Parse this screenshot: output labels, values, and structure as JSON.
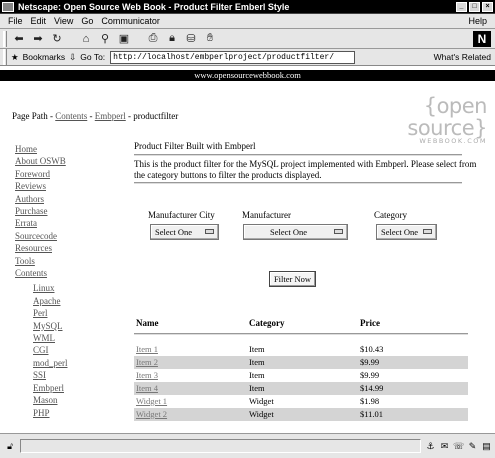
{
  "window": {
    "title": "Netscape: Open Source Web Book - Product Filter Emberl Style"
  },
  "menu": [
    "File",
    "Edit",
    "View",
    "Go",
    "Communicator"
  ],
  "menu_help": "Help",
  "toolbar_icons": [
    "back-icon",
    "forward-icon",
    "reload-icon",
    "home-icon",
    "search-icon",
    "netscape-icon",
    "print-icon",
    "security-icon",
    "shop-icon",
    "stop-icon"
  ],
  "location": {
    "bookmarks_label": "Bookmarks",
    "goto_label": "Go To:",
    "url": "http://localhost/embperlproject/productfilter/",
    "related_label": "What's Related"
  },
  "page": {
    "banner": "www.opensourcewebbook.com",
    "logo_big": "{open source}",
    "logo_small": "WEBBOOK.COM",
    "path": {
      "label": "Page Path - ",
      "contents": "Contents",
      "sep1": " - ",
      "embperl": "Embperl",
      "sep2": " - ",
      "current": "productfilter"
    },
    "nav": [
      "Home",
      "About OSWB",
      "Foreword",
      "Reviews",
      "Authors",
      "Purchase",
      "Errata",
      "Sourcecode",
      "Resources",
      "Tools",
      "Contents"
    ],
    "subnav": [
      "Linux",
      "Apache",
      "Perl",
      "MySQL",
      "WML",
      "CGI",
      "mod_perl",
      "SSI",
      "Embperl",
      "Mason",
      "PHP"
    ],
    "heading": "Product Filter Built with Embperl",
    "description": "This is the product filter for the MySQL project implemented with Embperl. Please select from the category buttons to filter the products displayed.",
    "filters": {
      "manufacturer_city_label": "Manufacturer City",
      "manufacturer_label": "Manufacturer",
      "category_label": "Category",
      "manufacturer_city_value": "Select One",
      "manufacturer_value": "Select One",
      "category_value": "Select One",
      "button": "Filter Now"
    },
    "table": {
      "headers": [
        "Name",
        "Category",
        "Price"
      ],
      "rows": [
        {
          "name": "Item 1",
          "category": "Item",
          "price": "$10.43"
        },
        {
          "name": "Item 2",
          "category": "Item",
          "price": "$9.99"
        },
        {
          "name": "Item 3",
          "category": "Item",
          "price": "$9.99"
        },
        {
          "name": "Item 4",
          "category": "Item",
          "price": "$14.99"
        },
        {
          "name": "Widget 1",
          "category": "Widget",
          "price": "$1.98"
        },
        {
          "name": "Widget 2",
          "category": "Widget",
          "price": "$11.01"
        }
      ]
    }
  }
}
